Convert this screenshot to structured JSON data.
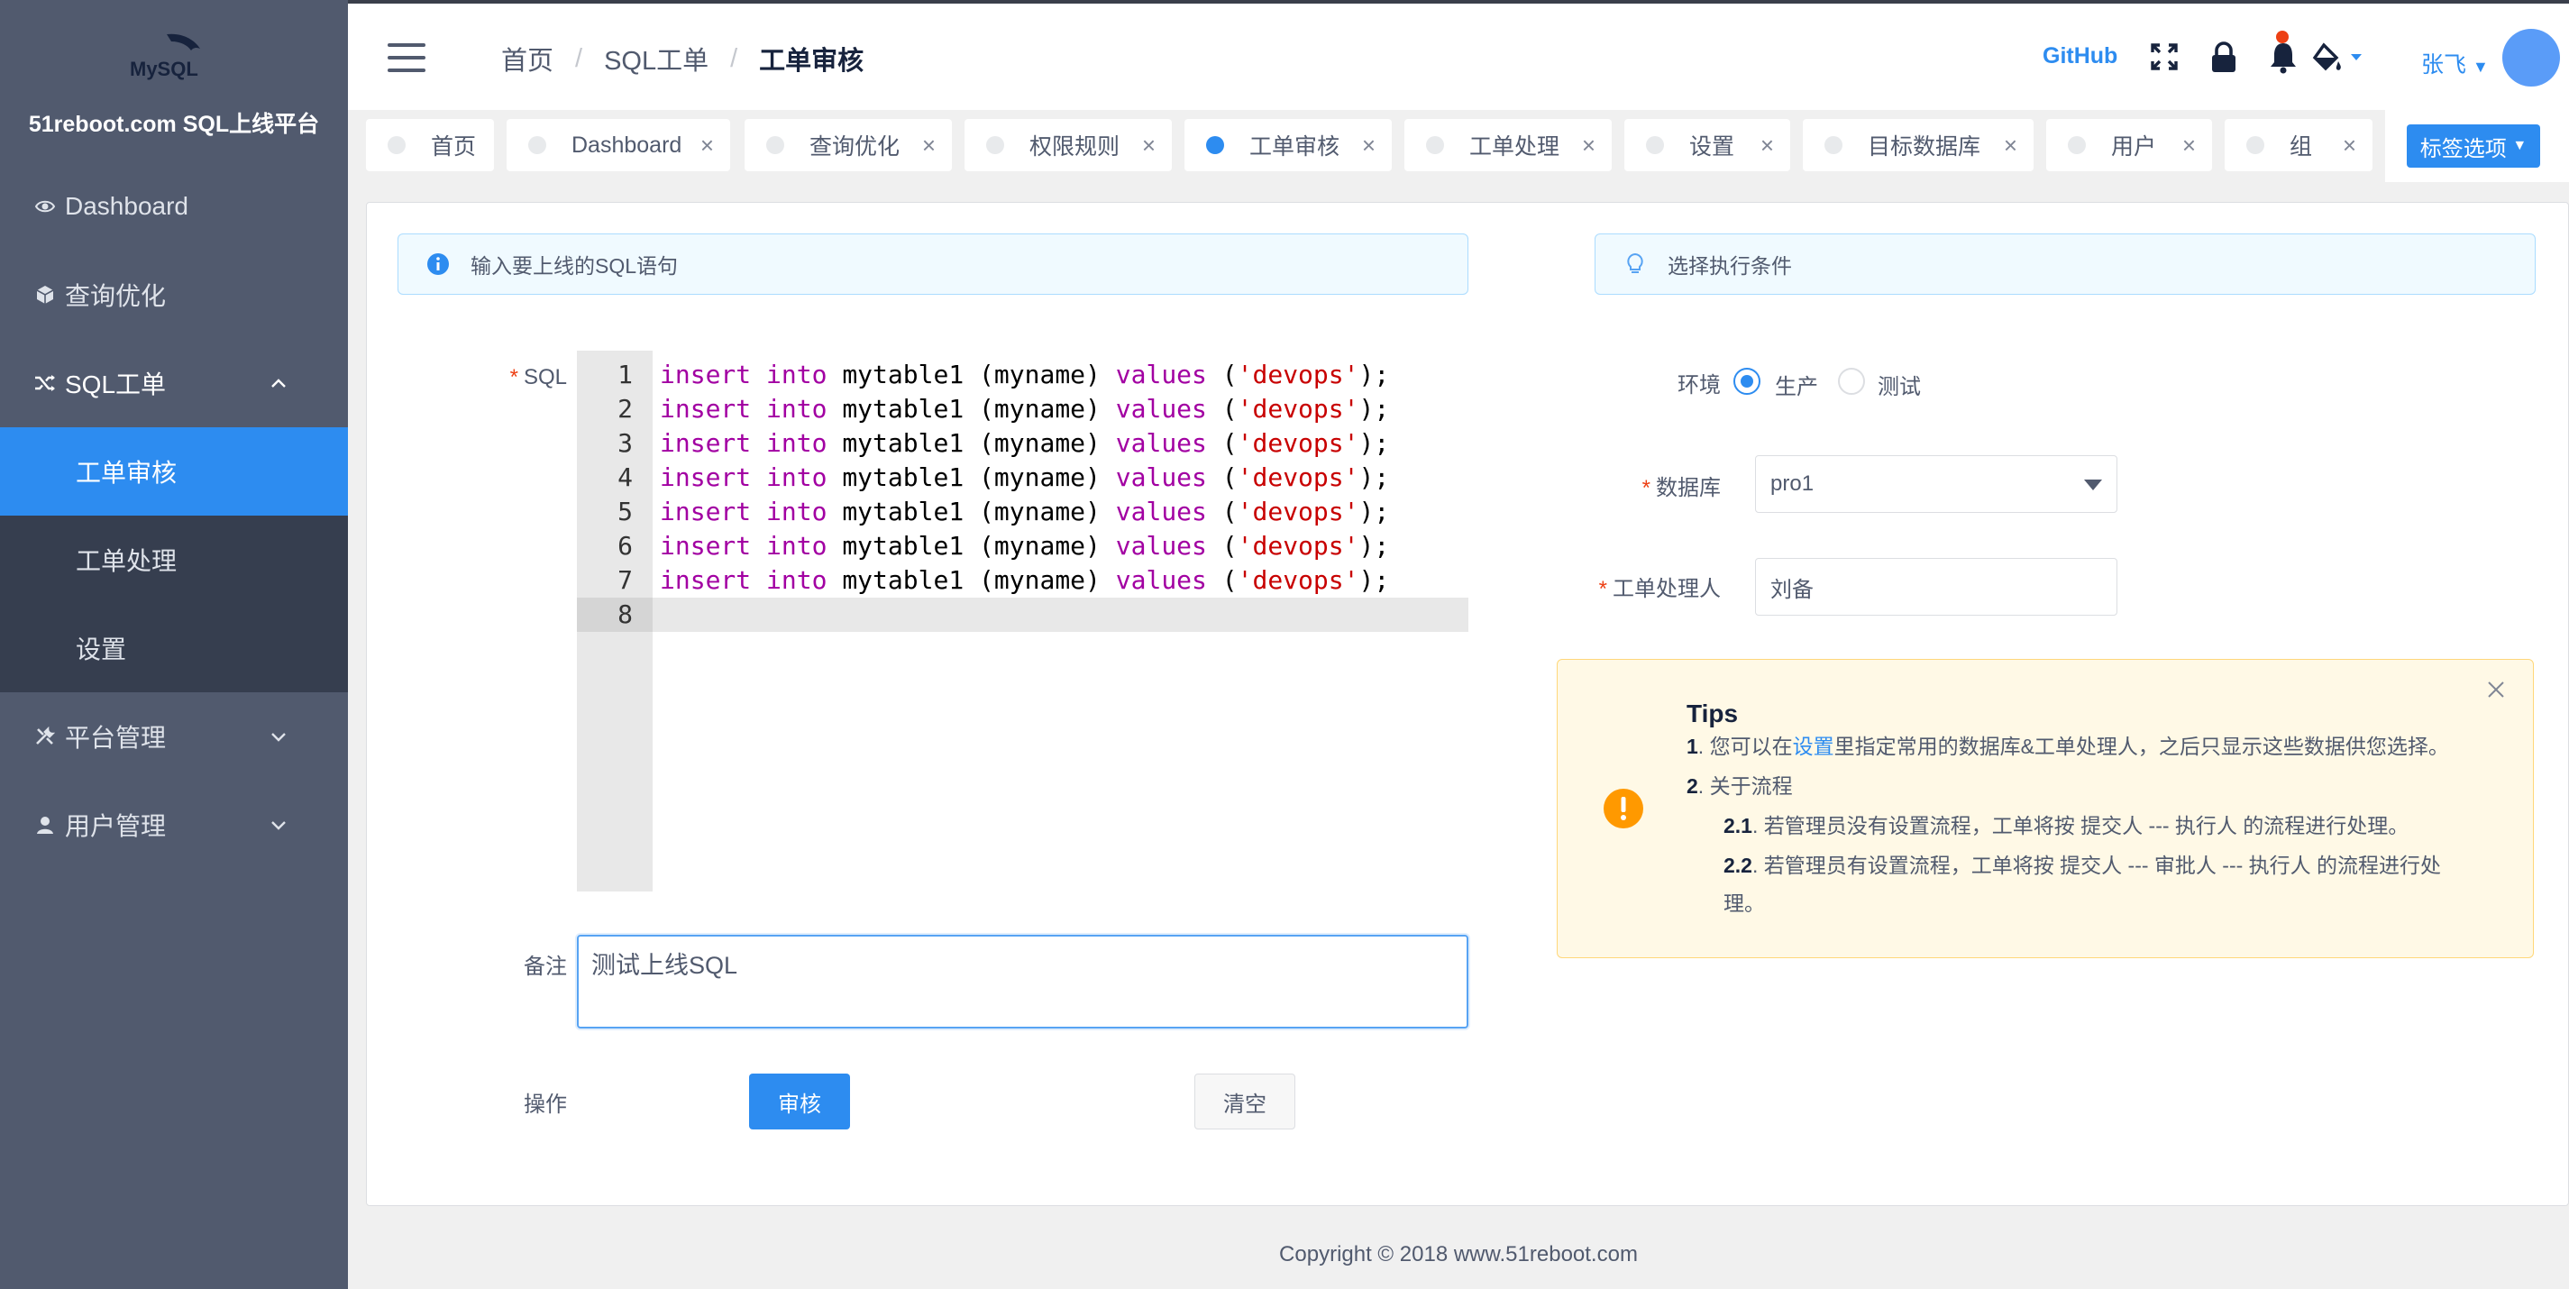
{
  "sidebar": {
    "logo_text": "MySQL",
    "brand": "51reboot.com SQL上线平台",
    "items": [
      {
        "label": "Dashboard",
        "icon": "eye-icon"
      },
      {
        "label": "查询优化",
        "icon": "cube-icon"
      },
      {
        "label": "SQL工单",
        "icon": "shuffle-icon"
      },
      {
        "label": "平台管理",
        "icon": "tools-icon"
      },
      {
        "label": "用户管理",
        "icon": "user-icon"
      }
    ],
    "sub_items": [
      "工单审核",
      "工单处理",
      "设置"
    ]
  },
  "header": {
    "breadcrumb": [
      "首页",
      "SQL工单",
      "工单审核"
    ],
    "breadcrumb_sep": "/",
    "github": "GitHub",
    "user": "张飞",
    "notification_dot_color": "#ed4014"
  },
  "tabs": {
    "items": [
      {
        "label": "首页",
        "active": false,
        "closable": false
      },
      {
        "label": "Dashboard",
        "active": false,
        "closable": true
      },
      {
        "label": "查询优化",
        "active": false,
        "closable": true
      },
      {
        "label": "权限规则",
        "active": false,
        "closable": true
      },
      {
        "label": "工单审核",
        "active": true,
        "closable": true
      },
      {
        "label": "工单处理",
        "active": false,
        "closable": true
      },
      {
        "label": "设置",
        "active": false,
        "closable": true
      },
      {
        "label": "目标数据库",
        "active": false,
        "closable": true
      },
      {
        "label": "用户",
        "active": false,
        "closable": true
      },
      {
        "label": "组",
        "active": false,
        "closable": true
      }
    ],
    "options_label": "标签选项",
    "close_glyph": "×"
  },
  "form": {
    "left_alert": "输入要上线的SQL语句",
    "right_alert": "选择执行条件",
    "sql_label": "SQL",
    "required_mark": "*",
    "code_lines": [
      "insert into mytable1 (myname) values ('devops');",
      "insert into mytable1 (myname) values ('devops');",
      "insert into mytable1 (myname) values ('devops');",
      "insert into mytable1 (myname) values ('devops');",
      "insert into mytable1 (myname) values ('devops');",
      "insert into mytable1 (myname) values ('devops');",
      "insert into mytable1 (myname) values ('devops');",
      ""
    ],
    "remark_label": "备注",
    "remark_value": "测试上线SQL",
    "action_label": "操作",
    "submit": "审核",
    "clear": "清空",
    "env_label": "环境",
    "env_options": [
      "生产",
      "测试"
    ],
    "env_selected": "生产",
    "db_label": "数据库",
    "db_value": "pro1",
    "handler_label": "工单处理人",
    "handler_value": "刘备"
  },
  "tips": {
    "title": "Tips",
    "line1_num": "1",
    "line1_a": ". 您可以在",
    "line1_link": "设置",
    "line1_b": "里指定常用的数据库&工单处理人，之后只显示这些数据供您选择。",
    "line2_num": "2",
    "line2": ". 关于流程",
    "line3_num": "2.1",
    "line3": ". 若管理员没有设置流程，工单将按 提交人 --- 执行人 的流程进行处理。",
    "line4_num": "2.2",
    "line4": ". 若管理员有设置流程，工单将按 提交人 --- 审批人 --- 执行人 的流程进行处",
    "line5": "理。"
  },
  "footer": "Copyright © 2018 www.51reboot.com",
  "colors": {
    "primary": "#2d8cf0",
    "sidebar": "#515a6e",
    "sidebar_sub": "#363e4f",
    "warning": "#ff9900"
  }
}
